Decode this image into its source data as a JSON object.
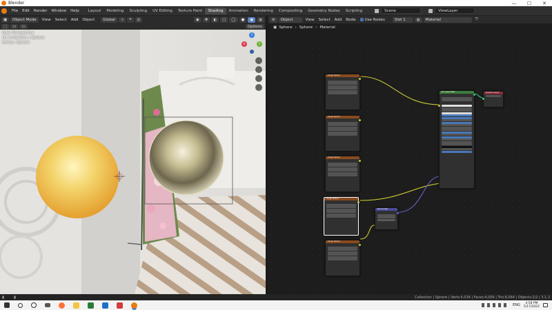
{
  "window": {
    "title": "Blender",
    "min": "—",
    "max": "☐",
    "close": "✕"
  },
  "menubar": {
    "menus": [
      "File",
      "Edit",
      "Render",
      "Window",
      "Help"
    ],
    "workspaces": [
      "Layout",
      "Modeling",
      "Sculpting",
      "UV Editing",
      "Texture Paint",
      "Shading",
      "Animation",
      "Rendering",
      "Compositing",
      "Geometry Nodes",
      "Scripting"
    ],
    "active_workspace": "Shading",
    "scene": "Scene",
    "view_layer": "ViewLayer"
  },
  "viewport": {
    "mode": "Object Mode",
    "menus": [
      "View",
      "Select",
      "Add",
      "Object"
    ],
    "orientation": "Global",
    "options_label": "Options",
    "overlay_lines": [
      "User Perspective",
      "(1) Collection | Sphere",
      "Active: Sphere"
    ],
    "gizmo": {
      "x": "X",
      "y": "Y",
      "z": "Z"
    }
  },
  "node_editor": {
    "editor_type": "Object",
    "menus": [
      "View",
      "Select",
      "Add",
      "Node"
    ],
    "use_nodes_label": "Use Nodes",
    "slot": "Slot 1",
    "material": "Material",
    "breadcrumb": [
      "Sphere",
      "Sphere",
      "Material"
    ],
    "nodes": {
      "image_texture_titles": [
        "Image Texture",
        "Image Texture",
        "Image Texture",
        "Image Texture",
        "Image Texture"
      ],
      "principled_title": "Principled BSDF",
      "output_title": "Material Output",
      "normal_map_title": "Normal Map"
    }
  },
  "statusbar": {
    "stats": "Collection | Sphere | Verts:4,034 | Faces:4,006 | Tris:8,064 | Objects:1/2 | 3.1.2"
  },
  "taskbar": {
    "lang": "ENG",
    "time": "4:58 PM",
    "date": "5/17/2022"
  },
  "colors": {
    "accent": "#e87d0d",
    "node_header_texture": "#8a4a1e",
    "node_header_shader": "#3b7d3b",
    "node_header_output": "#8a2a3a",
    "node_header_vector": "#4b4b9c",
    "wire_color": "#c8c832",
    "wire_vector": "#6363c7"
  }
}
